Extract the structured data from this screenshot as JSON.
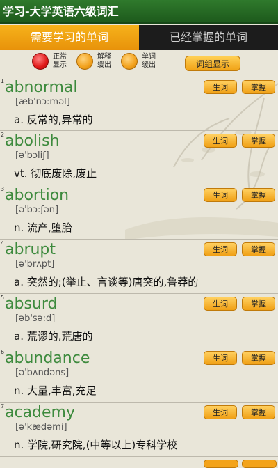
{
  "title": "学习-大学英语六级词汇",
  "tabs": [
    {
      "label": "需要学习的单词",
      "active": true
    },
    {
      "label": "已经掌握的单词",
      "active": false
    }
  ],
  "options": [
    {
      "label": "正常\n显示",
      "selected": true
    },
    {
      "label": "解释\n缓出",
      "selected": false
    },
    {
      "label": "单词\n缓出",
      "selected": false
    }
  ],
  "group_button": "词组显示",
  "item_buttons": {
    "learn": "生词",
    "master": "掌握"
  },
  "words": [
    {
      "num": "1",
      "word": "abnormal",
      "phonetic": "[æb'nɔ:məl]",
      "definition": "a. 反常的,异常的"
    },
    {
      "num": "2",
      "word": "abolish",
      "phonetic": "[ə'bɔliʃ]",
      "definition": "vt. 彻底废除,废止"
    },
    {
      "num": "3",
      "word": "abortion",
      "phonetic": "[ə'bɔ:ʃən]",
      "definition": "n. 流产,堕胎"
    },
    {
      "num": "4",
      "word": "abrupt",
      "phonetic": "[ə'brʌpt]",
      "definition": "a. 突然的;(举止、言谈等)唐突的,鲁莽的"
    },
    {
      "num": "5",
      "word": "absurd",
      "phonetic": "[əb'sə:d]",
      "definition": "a. 荒谬的,荒唐的"
    },
    {
      "num": "6",
      "word": "abundance",
      "phonetic": "[ə'bʌndəns]",
      "definition": "n. 大量,丰富,充足"
    },
    {
      "num": "7",
      "word": "academy",
      "phonetic": "[ə'kædəmi]",
      "definition": "n. 学院,研究院,(中等以上)专科学校"
    }
  ],
  "colors": {
    "title_bar": "#2f7a2c",
    "active_tab": "#f6b21b",
    "word_text": "#3d8a3d",
    "button": "#f0a016"
  }
}
